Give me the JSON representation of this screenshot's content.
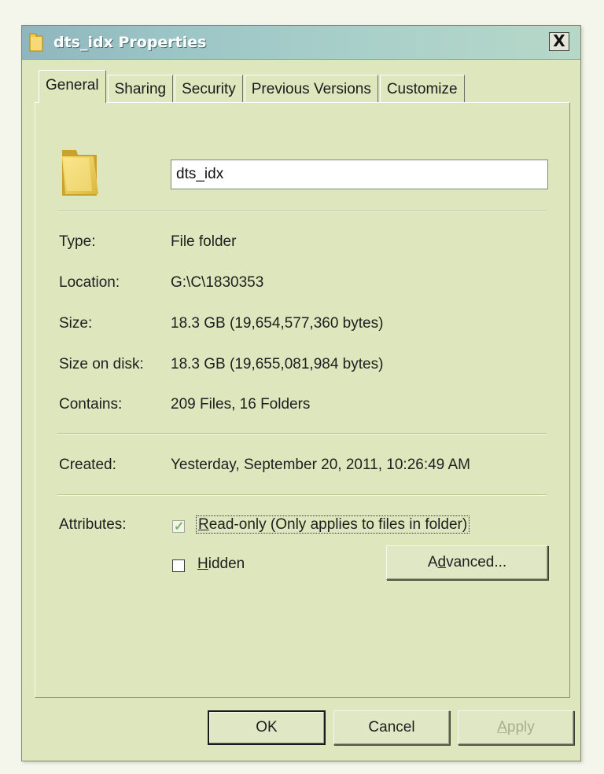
{
  "window": {
    "title": "dts_idx Properties",
    "close_glyph": "X"
  },
  "tabs": [
    {
      "label": "General",
      "active": true
    },
    {
      "label": "Sharing",
      "active": false
    },
    {
      "label": "Security",
      "active": false
    },
    {
      "label": "Previous Versions",
      "active": false
    },
    {
      "label": "Customize",
      "active": false
    }
  ],
  "general": {
    "folder_name": "dts_idx",
    "rows": {
      "type": {
        "label": "Type:",
        "value": "File folder"
      },
      "location": {
        "label": "Location:",
        "value": "G:\\C\\1830353"
      },
      "size": {
        "label": "Size:",
        "value": "18.3 GB (19,654,577,360 bytes)"
      },
      "size_on_disk": {
        "label": "Size on disk:",
        "value": "18.3 GB (19,655,081,984 bytes)"
      },
      "contains": {
        "label": "Contains:",
        "value": "209 Files, 16 Folders"
      },
      "created": {
        "label": "Created:",
        "value": "Yesterday, September 20, 2011, 10:26:49 AM"
      }
    },
    "attributes": {
      "label": "Attributes:",
      "readonly": {
        "text": "ead-only (Only applies to files in folder)",
        "accel": "R",
        "checked": true
      },
      "hidden": {
        "text": "idden",
        "accel": "H",
        "checked": false
      },
      "advanced_button": {
        "pre": "A",
        "accel": "d",
        "post": "vanced..."
      }
    }
  },
  "buttons": {
    "ok": "OK",
    "cancel": "Cancel",
    "apply": {
      "accel": "A",
      "rest": "pply",
      "enabled": false
    }
  },
  "colors": {
    "dialog_bg": "#dde6bd",
    "titlebar": "#9bc4c6",
    "checkmark": "#7fb26d"
  },
  "icons": {
    "title_icon": "folder-icon",
    "header_icon": "folder-icon"
  }
}
